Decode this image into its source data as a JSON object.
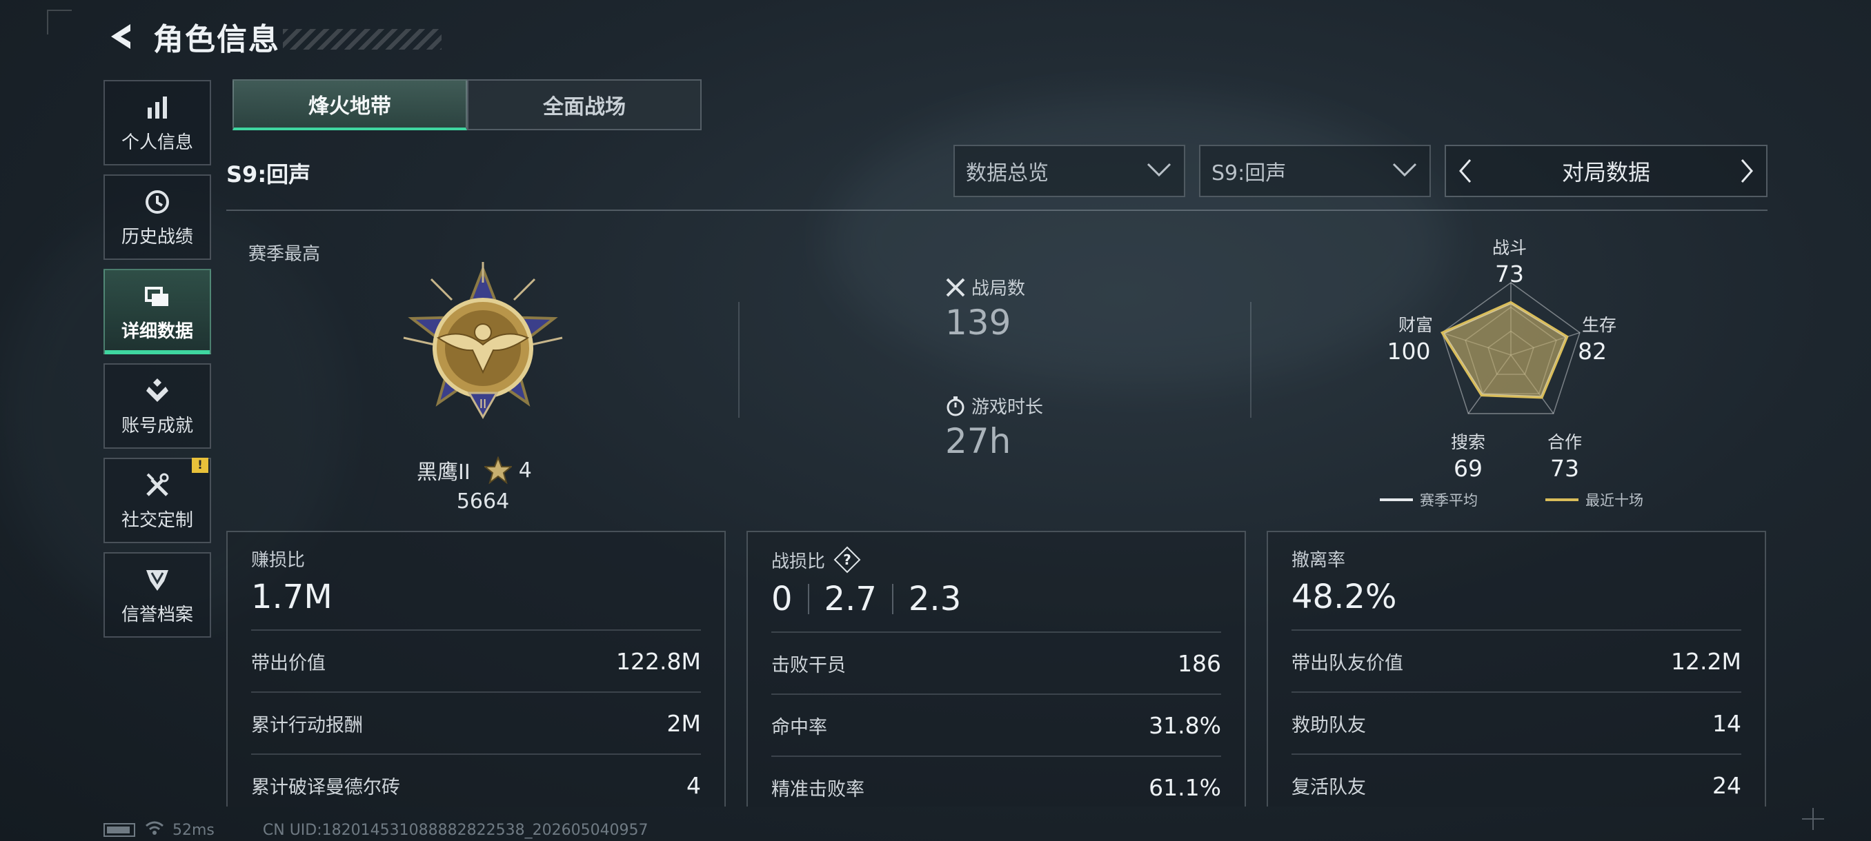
{
  "header": {
    "title": "角色信息"
  },
  "sidebar": {
    "items": [
      {
        "label": "个人信息",
        "icon": "bar-chart-icon"
      },
      {
        "label": "历史战绩",
        "icon": "clock-history-icon"
      },
      {
        "label": "详细数据",
        "icon": "folder-stack-icon",
        "active": true
      },
      {
        "label": "账号成就",
        "icon": "achievement-badge-icon"
      },
      {
        "label": "社交定制",
        "icon": "tools-icon",
        "badge": "!"
      },
      {
        "label": "信誉档案",
        "icon": "credit-shield-icon"
      }
    ]
  },
  "tabs": [
    {
      "label": "烽火地带",
      "active": true
    },
    {
      "label": "全面战场",
      "active": false
    }
  ],
  "season_label": "S9:回声",
  "filters": {
    "data_scope": "数据总览",
    "season": "S9:回声",
    "pager_label": "对局数据"
  },
  "overview": {
    "season_best_label": "赛季最高",
    "rank_name": "黑鹰II",
    "rank_stars": "4",
    "rank_score": "5664",
    "matches_label": "战局数",
    "matches_value": "139",
    "playtime_label": "游戏时长",
    "playtime_value": "27h"
  },
  "radar": {
    "labels": {
      "combat": "战斗",
      "survival": "生存",
      "cooperation": "合作",
      "search": "搜索",
      "wealth": "财富"
    },
    "values": {
      "combat": "73",
      "survival": "82",
      "cooperation": "73",
      "search": "69",
      "wealth": "100"
    },
    "legend_season_avg": "赛季平均",
    "legend_recent10": "最近十场",
    "colors": {
      "season_avg": "#e6e9ec",
      "recent10": "#d9bd5a"
    }
  },
  "cards": {
    "profit": {
      "title": "赚损比",
      "main": "1.7M",
      "rows": [
        {
          "k": "带出价值",
          "v": "122.8M"
        },
        {
          "k": "累计行动报酬",
          "v": "2M"
        },
        {
          "k": "累计破译曼德尔砖",
          "v": "4"
        }
      ]
    },
    "kd": {
      "title": "战损比",
      "help": "?",
      "values": [
        "0",
        "2.7",
        "2.3"
      ],
      "rows": [
        {
          "k": "击败干员",
          "v": "186"
        },
        {
          "k": "命中率",
          "v": "31.8%"
        },
        {
          "k": "精准击败率",
          "v": "61.1%"
        }
      ]
    },
    "extract": {
      "title": "撤离率",
      "main": "48.2%",
      "rows": [
        {
          "k": "带出队友价值",
          "v": "12.2M"
        },
        {
          "k": "救助队友",
          "v": "14"
        },
        {
          "k": "复活队友",
          "v": "24"
        }
      ]
    }
  },
  "footer": {
    "ping": "52ms",
    "uid": "CN UID:182014531088882822538_202605040957"
  },
  "colors": {
    "accent": "#3fd6a0",
    "badge": "#e8c13a"
  }
}
